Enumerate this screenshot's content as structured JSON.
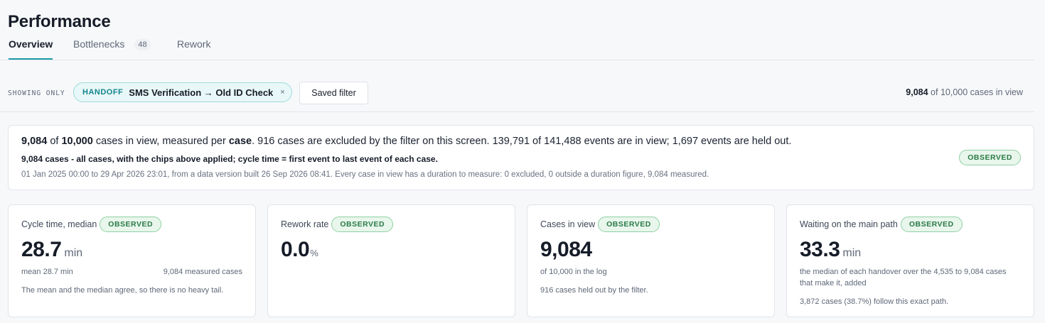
{
  "page": {
    "title": "Performance"
  },
  "tabs": [
    {
      "label": "Overview",
      "active": true
    },
    {
      "label": "Bottlenecks",
      "badge": "48"
    },
    {
      "label": "Rework"
    }
  ],
  "filter_bar": {
    "showing_only": "SHOWING ONLY",
    "chip": {
      "kind": "HANDOFF",
      "label": "SMS Verification → Old ID Check",
      "close": "×"
    },
    "saved_filter": "Saved filter",
    "cases_count": "9,084",
    "cases_rest": " of 10,000 cases in view"
  },
  "info": {
    "line1": {
      "cases": "9,084",
      "of": " of ",
      "total": "10,000",
      "mid": " cases in view, measured per ",
      "unit": "case",
      "rest": ". 916 cases are excluded by the filter on this screen. 139,791 of 141,488 events are in view; 1,697 events are held out."
    },
    "line2": "9,084 cases - all cases, with the chips above applied; cycle time = first event to last event of each case.",
    "line3": "01 Jan 2025 00:00 to 29 Apr 2026 23:01, from a data version built 26 Sep 2026 08:41. Every case in view has a duration to measure: 0 excluded, 0 outside a duration figure, 9,084 measured.",
    "badge": "OBSERVED"
  },
  "kpis": [
    {
      "label": "Cycle time, median",
      "badge": "OBSERVED",
      "value": "28.7",
      "unit": "min",
      "sub_left": "mean 28.7 min",
      "sub_right": "9,084 measured cases",
      "note": "The mean and the median agree, so there is no heavy tail."
    },
    {
      "label": "Rework rate",
      "badge": "OBSERVED",
      "value": "0.0",
      "unit": "%"
    },
    {
      "label": "Cases in view",
      "badge": "OBSERVED",
      "value": "9,084",
      "sub_left": "of 10,000 in the log",
      "note": "916 cases held out by the filter."
    },
    {
      "label": "Waiting on the main path",
      "badge": "OBSERVED",
      "value": "33.3",
      "unit": "min",
      "sub": "the median of each handover over the 4,535 to 9,084 cases that make it, added",
      "note": "3,872 cases (38.7%) follow this exact path."
    }
  ],
  "colors": {
    "accent": "#1d9aa8",
    "observed_text": "#2a7a45",
    "observed_bg": "#e8f6ec",
    "chip_bg": "#e8f7f7"
  }
}
